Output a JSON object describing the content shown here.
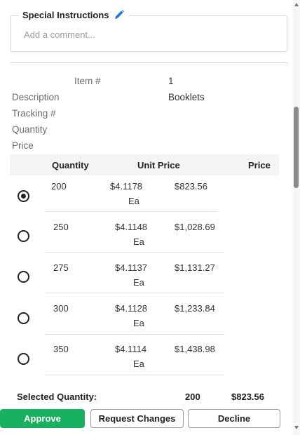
{
  "instructions": {
    "legend": "Special Instructions",
    "placeholder": "Add a comment..."
  },
  "details": {
    "item_label": "Item #",
    "item_value": "1",
    "description_label": "Description",
    "description_value": "Booklets",
    "tracking_label": "Tracking #",
    "quantity_label": "Quantity",
    "price_label": "Price"
  },
  "table": {
    "headers": {
      "quantity": "Quantity",
      "unit_price": "Unit Price",
      "price": "Price"
    },
    "unit_suffix": "Ea",
    "rows": [
      {
        "quantity": "200",
        "unit_price": "$4.1178",
        "price": "$823.56",
        "selected": true
      },
      {
        "quantity": "250",
        "unit_price": "$4.1148",
        "price": "$1,028.69",
        "selected": false
      },
      {
        "quantity": "275",
        "unit_price": "$4.1137",
        "price": "$1,131.27",
        "selected": false
      },
      {
        "quantity": "300",
        "unit_price": "$4.1128",
        "price": "$1,233.84",
        "selected": false
      },
      {
        "quantity": "350",
        "unit_price": "$4.1114",
        "price": "$1,438.98",
        "selected": false
      }
    ]
  },
  "summary": {
    "label": "Selected Quantity:",
    "quantity": "200",
    "price": "$823.56"
  },
  "actions": {
    "approve": "Approve",
    "request_changes": "Request Changes",
    "decline": "Decline"
  },
  "colors": {
    "approve": "#17b15f",
    "pencil": "#1a73e8"
  }
}
